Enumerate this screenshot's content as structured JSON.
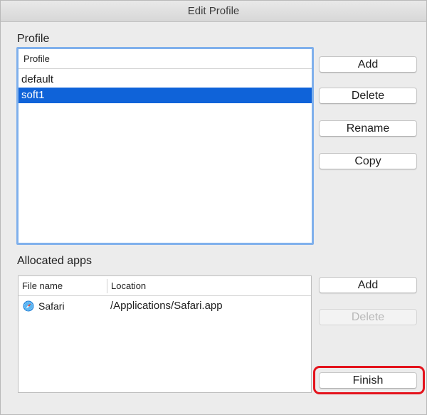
{
  "window": {
    "title": "Edit Profile"
  },
  "profile_section": {
    "label": "Profile",
    "column_header": "Profile",
    "items": [
      {
        "label": "default",
        "selected": false
      },
      {
        "label": "soft1",
        "selected": true
      }
    ],
    "buttons": {
      "add": "Add",
      "delete": "Delete",
      "rename": "Rename",
      "copy": "Copy"
    }
  },
  "apps_section": {
    "label": "Allocated apps",
    "columns": {
      "file_name": "File name",
      "location": "Location"
    },
    "rows": [
      {
        "file_name": "Safari",
        "location": "/Applications/Safari.app",
        "icon": "safari-icon"
      }
    ],
    "buttons": {
      "add": "Add",
      "delete": "Delete",
      "delete_enabled": false
    }
  },
  "footer": {
    "finish": "Finish",
    "finish_highlighted": true
  },
  "colors": {
    "selection": "#0f63d9",
    "focus_ring": "#7fb0ec",
    "annotation_ring": "#e4131c"
  }
}
